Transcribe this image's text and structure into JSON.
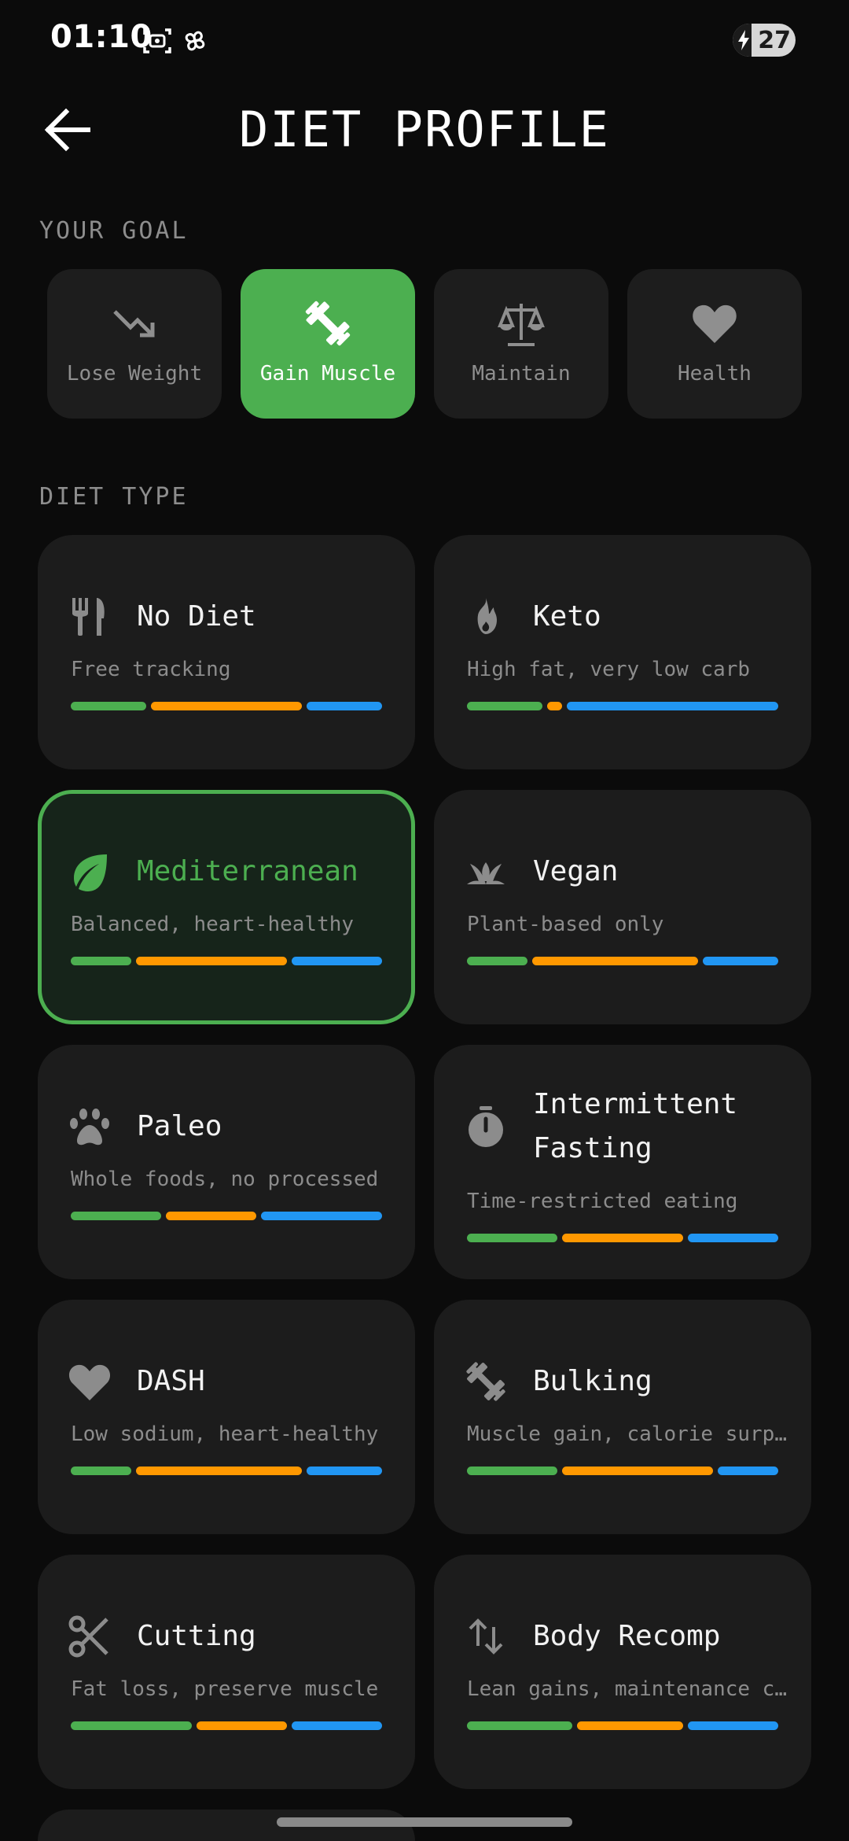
{
  "status_bar": {
    "time": "01:10",
    "battery": "27"
  },
  "header": {
    "title": "DIET PROFILE"
  },
  "goal_section": {
    "label": "YOUR GOAL",
    "goals": [
      {
        "label": "Lose Weight",
        "icon": "trending-down-icon",
        "active": false
      },
      {
        "label": "Gain Muscle",
        "icon": "dumbbell-icon",
        "active": true
      },
      {
        "label": "Maintain",
        "icon": "balance-scale-icon",
        "active": false
      },
      {
        "label": "Health",
        "icon": "heart-icon",
        "active": false
      }
    ]
  },
  "diet_section": {
    "label": "DIET TYPE",
    "diets": [
      {
        "name": "No Diet",
        "description": "Free tracking",
        "icon": "fork-knife-icon",
        "selected": false,
        "macros": {
          "protein": 25,
          "carbs": 50,
          "fat": 25
        }
      },
      {
        "name": "Keto",
        "description": "High fat, very low carb",
        "icon": "flame-icon",
        "selected": false,
        "macros": {
          "protein": 25,
          "carbs": 5,
          "fat": 70
        }
      },
      {
        "name": "Mediterranean",
        "description": "Balanced, heart-healthy",
        "icon": "leaf-icon",
        "selected": true,
        "macros": {
          "protein": 20,
          "carbs": 50,
          "fat": 30
        }
      },
      {
        "name": "Vegan",
        "description": "Plant-based only",
        "icon": "sprout-icon",
        "selected": false,
        "macros": {
          "protein": 20,
          "carbs": 55,
          "fat": 25
        }
      },
      {
        "name": "Paleo",
        "description": "Whole foods, no processed",
        "icon": "paw-icon",
        "selected": false,
        "macros": {
          "protein": 30,
          "carbs": 30,
          "fat": 40
        }
      },
      {
        "name": "Intermittent Fasting",
        "description": "Time-restricted eating",
        "icon": "stopwatch-icon",
        "selected": false,
        "macros": {
          "protein": 30,
          "carbs": 40,
          "fat": 30
        }
      },
      {
        "name": "DASH",
        "description": "Low sodium, heart-healthy",
        "icon": "heart-icon",
        "selected": false,
        "macros": {
          "protein": 20,
          "carbs": 55,
          "fat": 25
        }
      },
      {
        "name": "Bulking",
        "description": "Muscle gain, calorie surplus",
        "icon": "dumbbell-icon",
        "selected": false,
        "macros": {
          "protein": 30,
          "carbs": 50,
          "fat": 20
        }
      },
      {
        "name": "Cutting",
        "description": "Fat loss, preserve muscle",
        "icon": "scissors-icon",
        "selected": false,
        "macros": {
          "protein": 40,
          "carbs": 30,
          "fat": 30
        }
      },
      {
        "name": "Body Recomp",
        "description": "Lean gains, maintenance calories",
        "icon": "swap-vertical-icon",
        "selected": false,
        "macros": {
          "protein": 35,
          "carbs": 35,
          "fat": 30
        }
      }
    ]
  },
  "colors": {
    "accent": "#4caf50",
    "protein": "#4caf50",
    "carbs": "#ff9800",
    "fat": "#2196f3",
    "background": "#0b0b0b",
    "card": "#1c1c1c"
  }
}
